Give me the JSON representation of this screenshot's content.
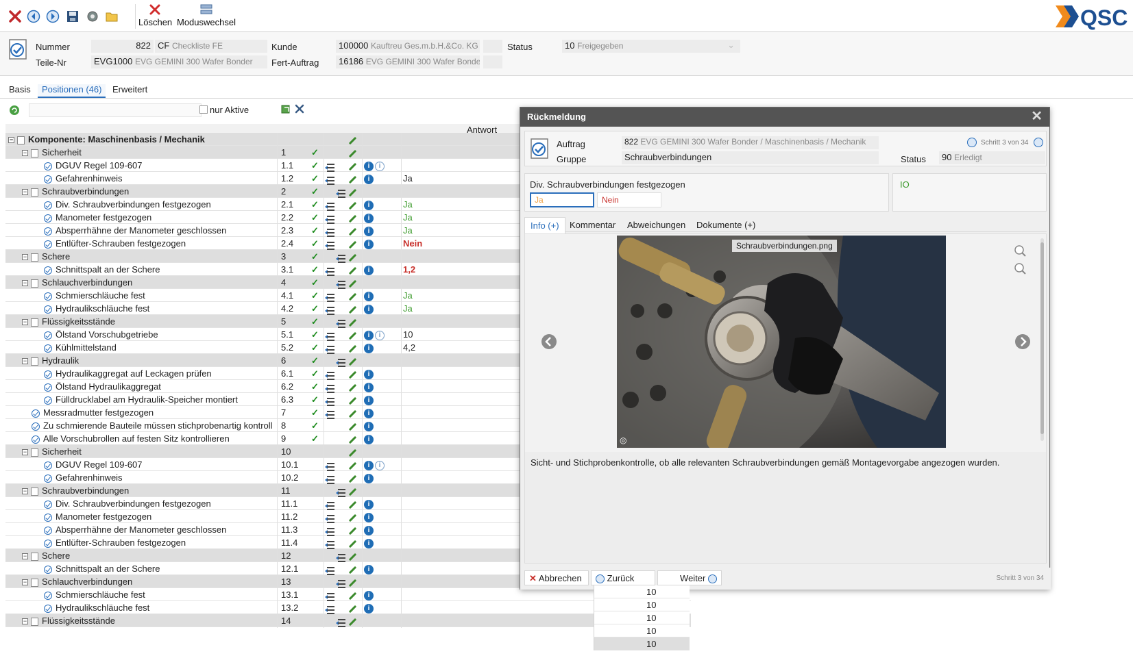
{
  "toolbar": {
    "delete_label": "Löschen",
    "mode_label": "Moduswechsel",
    "logo_text": "QSC"
  },
  "header": {
    "nummer_label": "Nummer",
    "nummer_value": "822",
    "nummer_type": "CF",
    "nummer_desc": "Checkliste FE",
    "teile_label": "Teile-Nr",
    "teile_value": "EVG1000",
    "teile_desc": "EVG GEMINI 300 Wafer Bonder",
    "kunde_label": "Kunde",
    "kunde_value": "100000",
    "kunde_desc": "Kauftreu Ges.m.b.H.&Co. KG",
    "fert_label": "Fert-Auftrag",
    "fert_value": "16186",
    "fert_desc": "EVG GEMINI 300 Wafer Bonder",
    "status_label": "Status",
    "status_value": "10",
    "status_desc": "Freigegeben"
  },
  "tabs": [
    "Basis",
    "Positionen (46)",
    "Erweitert"
  ],
  "filter": {
    "only_active_label": "nur Aktive"
  },
  "grid": {
    "answer_header": "Antwort",
    "rows": [
      {
        "kind": "comp",
        "name": "Komponente: Maschinenbasis / Mechanik",
        "num": "",
        "check": false,
        "list": false,
        "info": 0,
        "ans": "",
        "cls": ""
      },
      {
        "kind": "grp",
        "name": "Sicherheit",
        "num": "1",
        "check": true,
        "list": false,
        "info": 0,
        "ans": "",
        "cls": ""
      },
      {
        "kind": "item",
        "name": "DGUV Regel 109-607",
        "num": "1.1",
        "check": true,
        "list": true,
        "info": 2,
        "ans": "",
        "cls": ""
      },
      {
        "kind": "item",
        "name": "Gefahrenhinweis",
        "num": "1.2",
        "check": true,
        "list": true,
        "info": 1,
        "ans": "Ja",
        "cls": "val"
      },
      {
        "kind": "grp",
        "name": "Schraubverbindungen",
        "num": "2",
        "check": true,
        "list": true,
        "info": 0,
        "ans": "",
        "cls": ""
      },
      {
        "kind": "item",
        "name": "Div. Schraubverbindungen festgezogen",
        "num": "2.1",
        "check": true,
        "list": true,
        "info": 1,
        "ans": "Ja",
        "cls": "ja"
      },
      {
        "kind": "item",
        "name": "Manometer festgezogen",
        "num": "2.2",
        "check": true,
        "list": true,
        "info": 1,
        "ans": "Ja",
        "cls": "ja"
      },
      {
        "kind": "item",
        "name": "Absperrhähne der Manometer geschlossen",
        "num": "2.3",
        "check": true,
        "list": true,
        "info": 1,
        "ans": "Ja",
        "cls": "ja"
      },
      {
        "kind": "item",
        "name": "Entlüfter-Schrauben festgezogen",
        "num": "2.4",
        "check": true,
        "list": true,
        "info": 1,
        "ans": "Nein",
        "cls": "nein"
      },
      {
        "kind": "grp",
        "name": "Schere",
        "num": "3",
        "check": true,
        "list": true,
        "info": 0,
        "ans": "",
        "cls": ""
      },
      {
        "kind": "item",
        "name": "Schnittspalt an der Schere",
        "num": "3.1",
        "check": true,
        "list": true,
        "info": 1,
        "ans": "1,2",
        "cls": "red"
      },
      {
        "kind": "grp",
        "name": "Schlauchverbindungen",
        "num": "4",
        "check": true,
        "list": true,
        "info": 0,
        "ans": "",
        "cls": ""
      },
      {
        "kind": "item",
        "name": "Schmierschläuche fest",
        "num": "4.1",
        "check": true,
        "list": true,
        "info": 1,
        "ans": "Ja",
        "cls": "ja"
      },
      {
        "kind": "item",
        "name": "Hydraulikschläuche fest",
        "num": "4.2",
        "check": true,
        "list": true,
        "info": 1,
        "ans": "Ja",
        "cls": "ja"
      },
      {
        "kind": "grp",
        "name": "Flüssigkeitsstände",
        "num": "5",
        "check": true,
        "list": true,
        "info": 0,
        "ans": "",
        "cls": ""
      },
      {
        "kind": "item",
        "name": "Ölstand Vorschubgetriebe",
        "num": "5.1",
        "check": true,
        "list": true,
        "info": 2,
        "ans": "10",
        "cls": "val"
      },
      {
        "kind": "item",
        "name": "Kühlmittelstand",
        "num": "5.2",
        "check": true,
        "list": true,
        "info": 1,
        "ans": "4,2",
        "cls": "val"
      },
      {
        "kind": "grp",
        "name": "Hydraulik",
        "num": "6",
        "check": true,
        "list": true,
        "info": 0,
        "ans": "",
        "cls": ""
      },
      {
        "kind": "item",
        "name": "Hydraulikaggregat auf Leckagen prüfen",
        "num": "6.1",
        "check": true,
        "list": true,
        "info": 1,
        "ans": "",
        "cls": ""
      },
      {
        "kind": "item",
        "name": "Ölstand Hydraulikaggregat",
        "num": "6.2",
        "check": true,
        "list": true,
        "info": 1,
        "ans": "",
        "cls": ""
      },
      {
        "kind": "item",
        "name": "Fülldrucklabel am Hydraulik-Speicher montiert",
        "num": "6.3",
        "check": true,
        "list": true,
        "info": 1,
        "ans": "",
        "cls": ""
      },
      {
        "kind": "top",
        "name": "Messradmutter festgezogen",
        "num": "7",
        "check": true,
        "list": true,
        "info": 1,
        "ans": "",
        "cls": ""
      },
      {
        "kind": "top",
        "name": "Zu schmierende Bauteile müssen stichprobenartig kontrolli...",
        "num": "8",
        "check": true,
        "list": false,
        "info": 1,
        "ans": "",
        "cls": ""
      },
      {
        "kind": "top",
        "name": "Alle Vorschubrollen auf festen Sitz kontrollieren",
        "num": "9",
        "check": true,
        "list": false,
        "info": 1,
        "ans": "",
        "cls": ""
      },
      {
        "kind": "grp",
        "name": "Sicherheit",
        "num": "10",
        "check": false,
        "list": false,
        "info": 0,
        "ans": "",
        "cls": ""
      },
      {
        "kind": "item",
        "name": "DGUV Regel 109-607",
        "num": "10.1",
        "check": false,
        "list": true,
        "info": 2,
        "ans": "",
        "cls": ""
      },
      {
        "kind": "item",
        "name": "Gefahrenhinweis",
        "num": "10.2",
        "check": false,
        "list": true,
        "info": 1,
        "ans": "",
        "cls": ""
      },
      {
        "kind": "grp",
        "name": "Schraubverbindungen",
        "num": "11",
        "check": false,
        "list": true,
        "info": 0,
        "ans": "",
        "cls": ""
      },
      {
        "kind": "item",
        "name": "Div. Schraubverbindungen festgezogen",
        "num": "11.1",
        "check": false,
        "list": true,
        "info": 1,
        "ans": "",
        "cls": ""
      },
      {
        "kind": "item",
        "name": "Manometer festgezogen",
        "num": "11.2",
        "check": false,
        "list": true,
        "info": 1,
        "ans": "",
        "cls": ""
      },
      {
        "kind": "item",
        "name": "Absperrhähne der Manometer geschlossen",
        "num": "11.3",
        "check": false,
        "list": true,
        "info": 1,
        "ans": "",
        "cls": ""
      },
      {
        "kind": "item",
        "name": "Entlüfter-Schrauben festgezogen",
        "num": "11.4",
        "check": false,
        "list": true,
        "info": 1,
        "ans": "",
        "cls": ""
      },
      {
        "kind": "grp",
        "name": "Schere",
        "num": "12",
        "check": false,
        "list": true,
        "info": 0,
        "ans": "",
        "cls": ""
      },
      {
        "kind": "item",
        "name": "Schnittspalt an der Schere",
        "num": "12.1",
        "check": false,
        "list": true,
        "info": 1,
        "ans": "",
        "cls": ""
      },
      {
        "kind": "grp",
        "name": "Schlauchverbindungen",
        "num": "13",
        "check": false,
        "list": true,
        "info": 0,
        "ans": "",
        "cls": ""
      },
      {
        "kind": "item",
        "name": "Schmierschläuche fest",
        "num": "13.1",
        "check": false,
        "list": true,
        "info": 1,
        "ans": "",
        "cls": ""
      },
      {
        "kind": "item",
        "name": "Hydraulikschläuche fest",
        "num": "13.2",
        "check": false,
        "list": true,
        "info": 1,
        "ans": "",
        "cls": ""
      },
      {
        "kind": "grp",
        "name": "Flüssigkeitsstände",
        "num": "14",
        "check": false,
        "list": true,
        "info": 0,
        "ans": "",
        "cls": ""
      }
    ],
    "extra_values": [
      "10",
      "10",
      "10",
      "10",
      "10"
    ]
  },
  "dialog": {
    "title": "Rückmeldung",
    "auftrag_label": "Auftrag",
    "auftrag_value": "822",
    "auftrag_desc": "EVG GEMINI 300 Wafer Bonder / Maschinenbasis / Mechanik",
    "gruppe_label": "Gruppe",
    "gruppe_value": "Schraubverbindungen",
    "step_text": "Schritt 3 von 34",
    "status_label": "Status",
    "status_value": "90",
    "status_desc": "Erledigt",
    "question": "Div. Schraubverbindungen festgezogen",
    "answer_yes": "Ja",
    "answer_no": "Nein",
    "result": "IO",
    "tabs": [
      "Info (+)",
      "Kommentar",
      "Abweichungen",
      "Dokumente (+)"
    ],
    "image_name": "Schraubverbindungen.png",
    "description": "Sicht- und Stichprobenkontrolle, ob alle relevanten Schraubverbindungen gemäß Montagevorgabe angezogen wurden.",
    "cancel_label": "Abbrechen",
    "back_label": "Zurück",
    "next_label": "Weiter",
    "footer_step": "Schritt 3 von 34"
  }
}
